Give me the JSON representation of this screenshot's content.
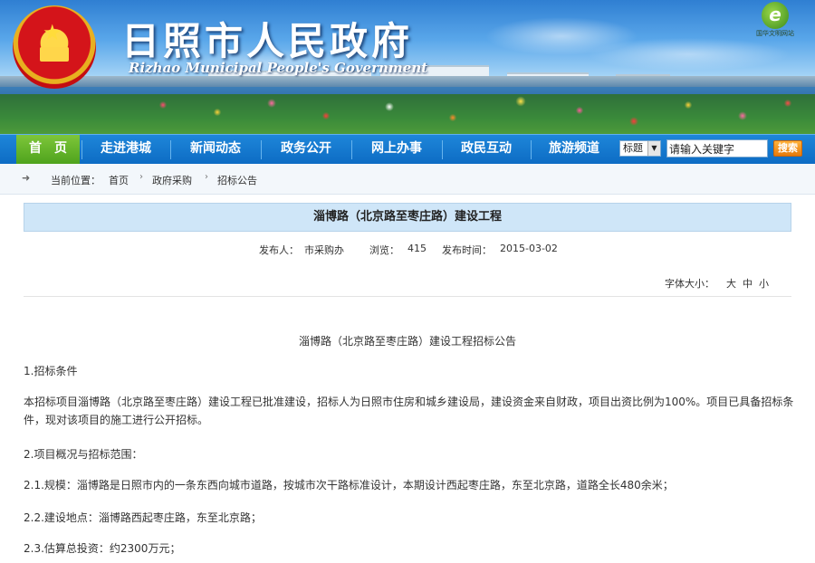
{
  "header": {
    "title": "日照市人民政府",
    "subtitle": "Rizhao Municipal People's Government",
    "badge_text": "国华文明网站"
  },
  "nav": {
    "items": [
      "首　页",
      "走进港城",
      "新闻动态",
      "政务公开",
      "网上办事",
      "政民互动",
      "旅游频道"
    ],
    "active_index": 0
  },
  "search": {
    "select_value": "标题",
    "input_value": "请输入关键字",
    "button_label": "搜索"
  },
  "breadcrumb": {
    "label": "当前位置：",
    "items": [
      "首页",
      "政府采购",
      "招标公告"
    ]
  },
  "article": {
    "title": "淄博路（北京路至枣庄路）建设工程",
    "meta": {
      "publisher_label": "发布人：",
      "publisher": "市采购办",
      "views_label": "浏览：",
      "views": "415",
      "date_label": "发布时间：",
      "date": "2015-03-02"
    },
    "font_size": {
      "label": "字体大小：",
      "large": "大",
      "medium": "中",
      "small": "小"
    },
    "heading": "淄博路（北京路至枣庄路）建设工程招标公告",
    "paragraphs": [
      "1.招标条件",
      "本招标项目淄博路（北京路至枣庄路）建设工程已批准建设，招标人为日照市住房和城乡建设局，建设资金来自财政，项目出资比例为100%。项目已具备招标条件，现对该项目的施工进行公开招标。",
      "2.项目概况与招标范围：",
      "2.1.规模：淄博路是日照市内的一条东西向城市道路，按城市次干路标准设计，本期设计西起枣庄路，东至北京路，道路全长480余米；",
      "2.2.建设地点：淄博路西起枣庄路，东至北京路；",
      "2.3.估算总投资：约2300万元；"
    ]
  }
}
